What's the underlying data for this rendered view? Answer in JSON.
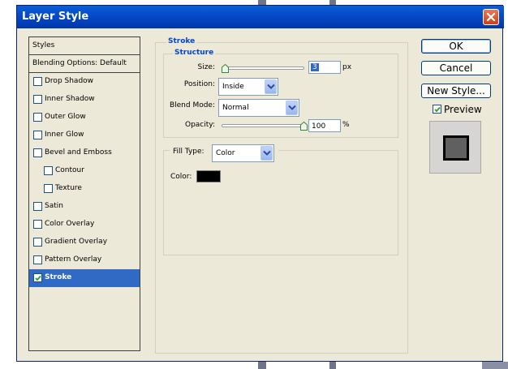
{
  "window": {
    "title": "Layer Style"
  },
  "styles_panel": {
    "header": "Styles",
    "items": [
      {
        "label": "Blending Options: Default",
        "has_checkbox": false,
        "checked": false,
        "selected": false,
        "indent": false
      },
      {
        "label": "Drop Shadow",
        "has_checkbox": true,
        "checked": false,
        "selected": false,
        "indent": false
      },
      {
        "label": "Inner Shadow",
        "has_checkbox": true,
        "checked": false,
        "selected": false,
        "indent": false
      },
      {
        "label": "Outer Glow",
        "has_checkbox": true,
        "checked": false,
        "selected": false,
        "indent": false
      },
      {
        "label": "Inner Glow",
        "has_checkbox": true,
        "checked": false,
        "selected": false,
        "indent": false
      },
      {
        "label": "Bevel and Emboss",
        "has_checkbox": true,
        "checked": false,
        "selected": false,
        "indent": false
      },
      {
        "label": "Contour",
        "has_checkbox": true,
        "checked": false,
        "selected": false,
        "indent": true
      },
      {
        "label": "Texture",
        "has_checkbox": true,
        "checked": false,
        "selected": false,
        "indent": true
      },
      {
        "label": "Satin",
        "has_checkbox": true,
        "checked": false,
        "selected": false,
        "indent": false
      },
      {
        "label": "Color Overlay",
        "has_checkbox": true,
        "checked": false,
        "selected": false,
        "indent": false
      },
      {
        "label": "Gradient Overlay",
        "has_checkbox": true,
        "checked": false,
        "selected": false,
        "indent": false
      },
      {
        "label": "Pattern Overlay",
        "has_checkbox": true,
        "checked": false,
        "selected": false,
        "indent": false
      },
      {
        "label": "Stroke",
        "has_checkbox": true,
        "checked": true,
        "selected": true,
        "indent": false
      }
    ]
  },
  "stroke": {
    "group_title": "Stroke",
    "structure_title": "Structure",
    "size": {
      "label": "Size:",
      "value": "3",
      "unit": "px"
    },
    "position": {
      "label": "Position:",
      "value": "Inside"
    },
    "blend_mode": {
      "label": "Blend Mode:",
      "value": "Normal"
    },
    "opacity": {
      "label": "Opacity:",
      "value": "100",
      "unit": "%"
    },
    "fill_type": {
      "label": "Fill Type:",
      "value": "Color"
    },
    "color": {
      "label": "Color:",
      "swatch": "#000000"
    }
  },
  "buttons": {
    "ok": "OK",
    "cancel": "Cancel",
    "new_style": "New Style...",
    "preview_label": "Preview",
    "preview_checked": true
  },
  "colors": {
    "title_bar": "#0447c5",
    "selection": "#316ac5",
    "group_title": "#0046d5",
    "dialog_bg": "#ece9d8"
  },
  "icons": {
    "close": "close-icon",
    "dropdown": "chevron-down-icon",
    "checkbox_checked": "checkmark-icon",
    "slider_thumb": "slider-thumb-icon"
  }
}
